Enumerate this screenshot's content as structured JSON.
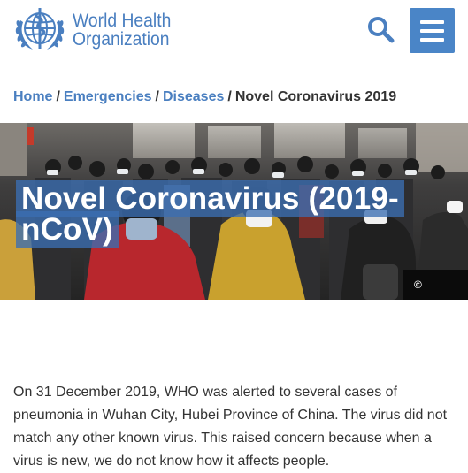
{
  "header": {
    "logo_line1": "World Health",
    "logo_line2": "Organization",
    "search_icon": "search-icon",
    "menu_icon": "hamburger-menu-icon",
    "brand_color": "#4a7fc0",
    "menu_bg_color": "#4a85c7"
  },
  "breadcrumb": {
    "items": [
      {
        "label": "Home"
      },
      {
        "label": "Emergencies"
      },
      {
        "label": "Diseases"
      }
    ],
    "current": "Novel Coronavirus 2019",
    "separator": "/"
  },
  "hero": {
    "title": "Novel Coronavirus (2019-nCoV)",
    "copyright_symbol": "©",
    "title_bg_color": "#3b6eb2"
  },
  "content": {
    "intro": "On 31 December 2019, WHO was alerted to several cases of pneumonia in Wuhan City, Hubei Province of China. The virus did not match any other known virus. This raised concern because when a virus is new, we do not know how it affects people."
  }
}
